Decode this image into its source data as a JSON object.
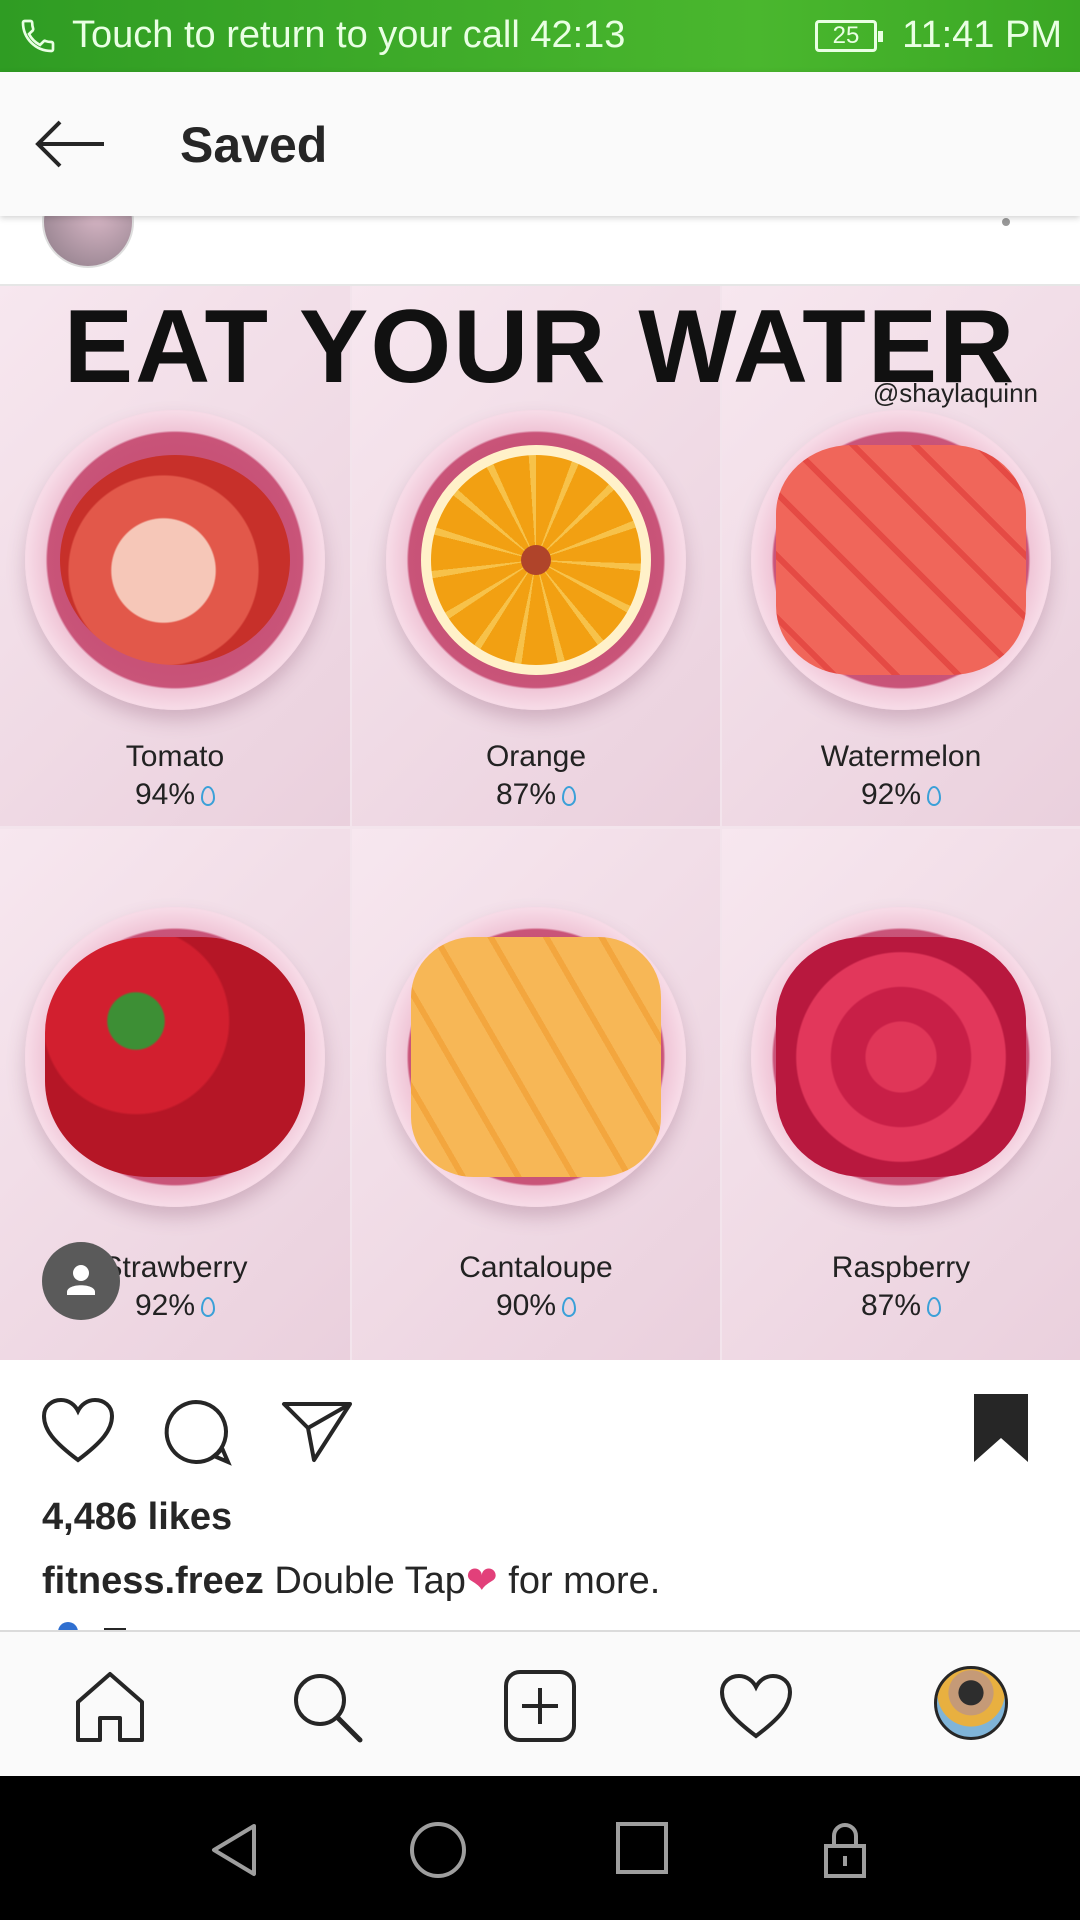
{
  "status_bar": {
    "call_text": "Touch to return to your call",
    "call_timer": "42:13",
    "battery": "25",
    "time": "11:41 PM",
    "bar_color": "#3aa724"
  },
  "header": {
    "title": "Saved"
  },
  "post": {
    "image": {
      "headline": "EAT YOUR WATER",
      "credit": "@shaylaquinn",
      "items": [
        {
          "name": "Tomato",
          "percent": "94%"
        },
        {
          "name": "Orange",
          "percent": "87%"
        },
        {
          "name": "Watermelon",
          "percent": "92%"
        },
        {
          "name": "Strawberry",
          "percent": "92%"
        },
        {
          "name": "Cantaloupe",
          "percent": "90%"
        },
        {
          "name": "Raspberry",
          "percent": "87%"
        }
      ]
    },
    "likes": "4,486 likes",
    "caption": {
      "username": "fitness.freez",
      "text_before": "Double Tap",
      "emoji": "❤",
      "text_after": " for more."
    }
  },
  "icons": {
    "like": "heart-outline-icon",
    "comment": "comment-icon",
    "share": "send-icon",
    "save": "bookmark-filled-icon"
  },
  "colors": {
    "heart_emoji": "#e2407a",
    "link_blue": "#3897f0"
  }
}
